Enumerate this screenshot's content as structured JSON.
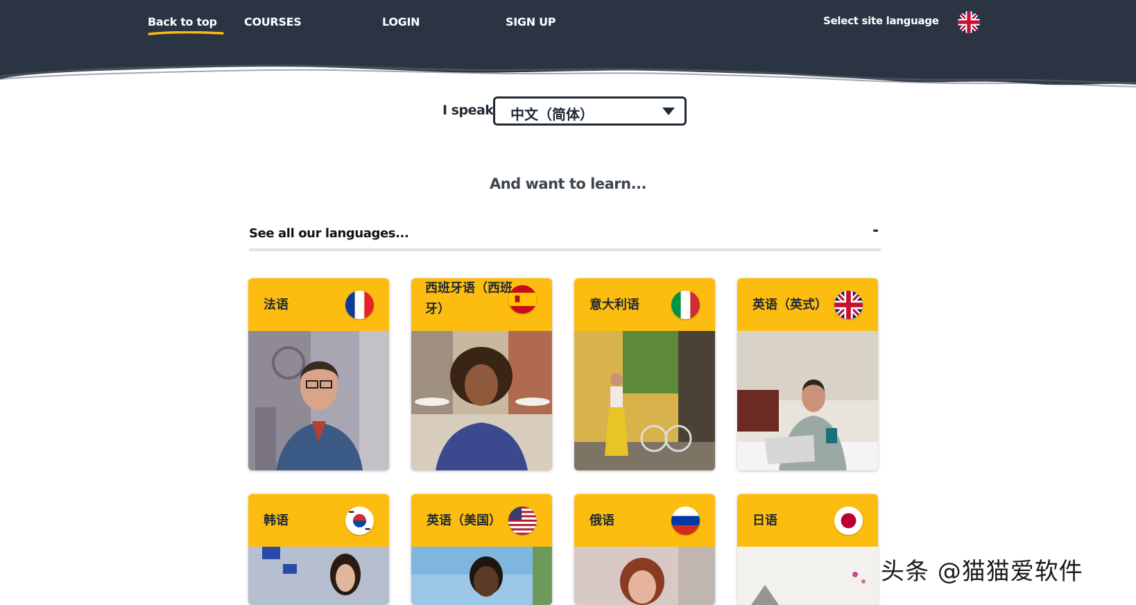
{
  "nav": {
    "back_to_top": "Back to top",
    "courses": "COURSES",
    "login": "LOGIN",
    "signup": "SIGN UP",
    "site_language": "Select site language",
    "site_language_flag": "uk-flag-icon"
  },
  "speak": {
    "label": "I speak",
    "selected": "中文（简体）"
  },
  "want_heading": "And want to learn...",
  "languages_toggle": {
    "label": "See all our languages...",
    "collapse_symbol": "-"
  },
  "courses": [
    {
      "name": "法语",
      "flag": "france-flag-icon"
    },
    {
      "name": "西班牙语（西班牙）",
      "flag": "spain-flag-icon"
    },
    {
      "name": "意大利语",
      "flag": "italy-flag-icon"
    },
    {
      "name": "英语（英式）",
      "flag": "uk-flag-icon"
    },
    {
      "name": "韩语",
      "flag": "korea-flag-icon"
    },
    {
      "name": "英语（美国）",
      "flag": "usa-flag-icon"
    },
    {
      "name": "俄语",
      "flag": "russia-flag-icon"
    },
    {
      "name": "日语",
      "flag": "japan-flag-icon"
    }
  ],
  "colors": {
    "header_bg": "#2b3442",
    "card_accent": "#fdbd10",
    "underline": "#fdbd10"
  },
  "watermark": "头条 @猫猫爱软件"
}
